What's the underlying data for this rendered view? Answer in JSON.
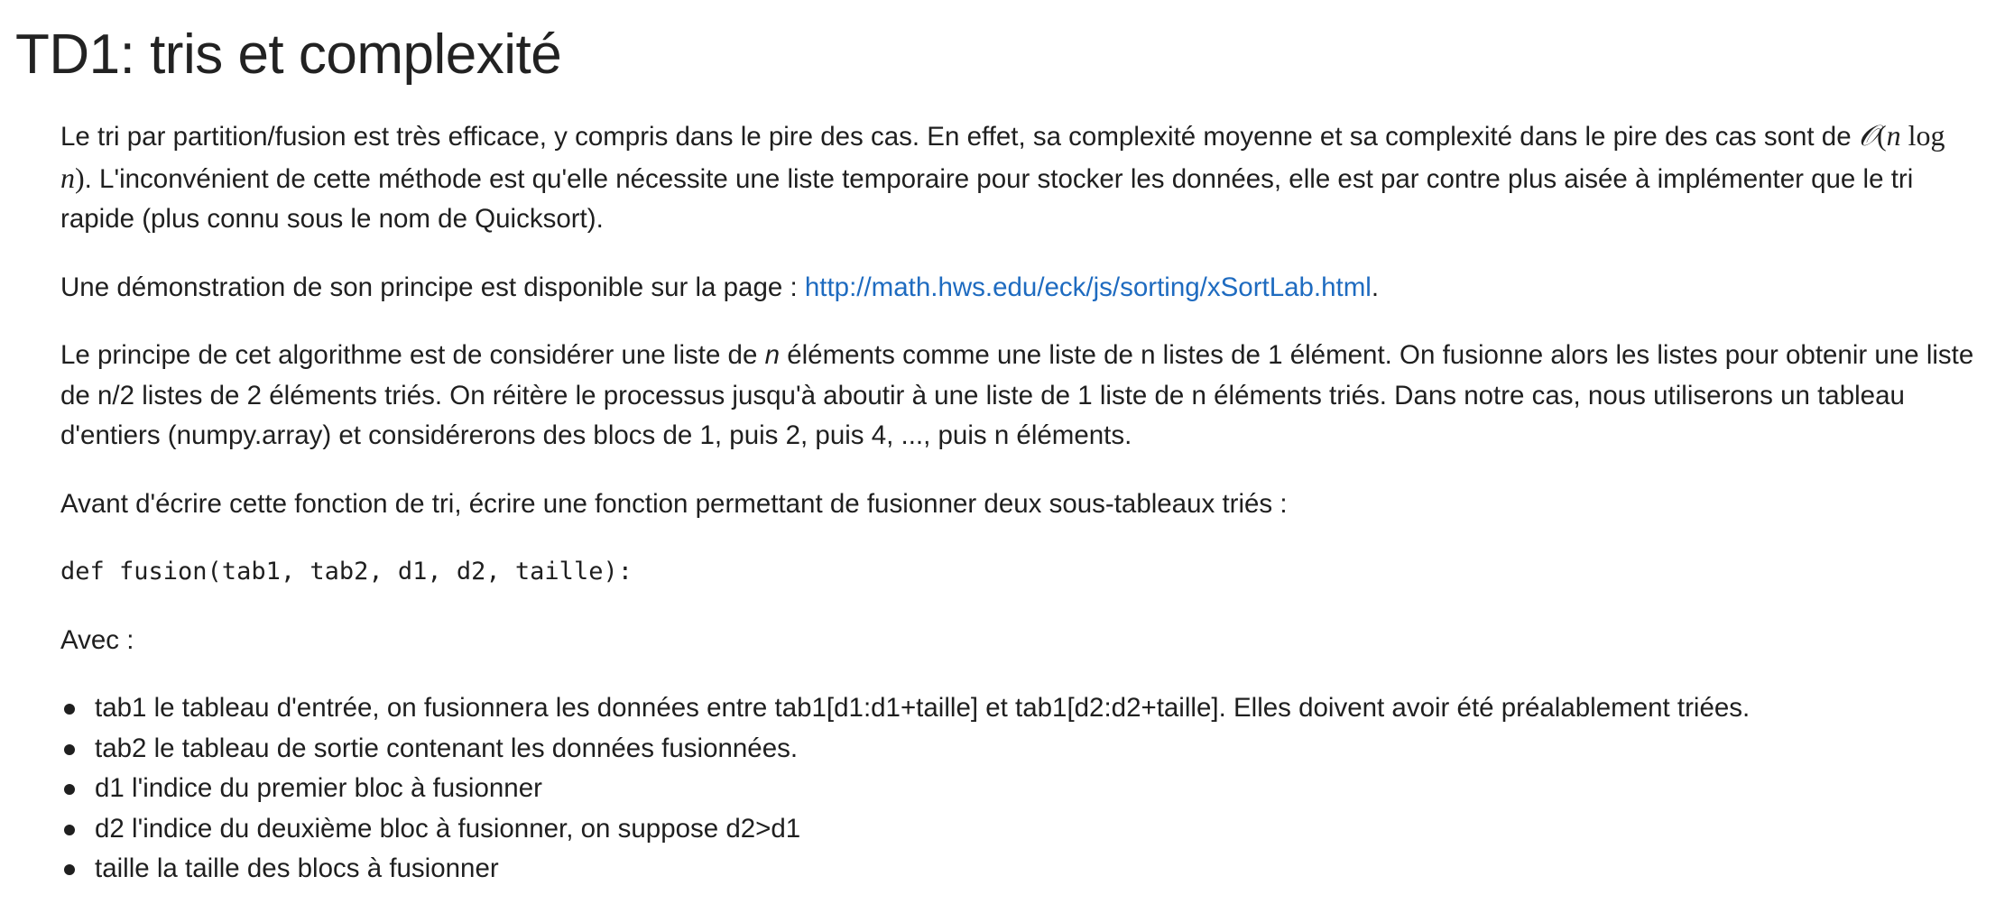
{
  "title": "TD1: tris et complexité",
  "paragraphs": {
    "p1": {
      "part1": "Le tri par partition/fusion est très efficace, y compris dans le pire des cas. En effet, sa complexité moyenne et sa complexité dans le pire des cas sont de ",
      "math_O": "𝒪",
      "math_open": "(",
      "math_n1": "n",
      "math_log": " log ",
      "math_n2": "n",
      "math_close": ")",
      "part2": ". L'inconvénient de cette méthode est qu'elle nécessite une liste temporaire pour stocker les données, elle est par contre plus aisée à implémenter que le tri rapide (plus connu sous le nom de Quicksort)."
    },
    "p2": {
      "before_link": "Une démonstration de son principe est disponible sur la page : ",
      "link_text": "http://math.hws.edu/eck/js/sorting/xSortLab.html",
      "after_link": "."
    },
    "p3": {
      "part1": "Le principe de cet algorithme est de considérer une liste de ",
      "var_n": "n",
      "part2": " éléments comme une liste de n listes de 1 élément. On fusionne alors les listes pour obtenir une liste de n/2 listes de 2 éléments triés. On réitère le processus jusqu'à aboutir à une liste de 1 liste de n éléments triés. Dans notre cas, nous utiliserons un tableau d'entiers (numpy.array) et considérerons des blocs de 1, puis 2, puis 4, ..., puis n éléments."
    },
    "p4": "Avant d'écrire cette fonction de tri, écrire une fonction permettant de fusionner deux sous-tableaux triés :",
    "code": "def fusion(tab1, tab2, d1, d2, taille):",
    "p5": "Avec :"
  },
  "params": [
    "tab1 le tableau d'entrée, on fusionnera les données entre tab1[d1:d1+taille] et tab1[d2:d2+taille]. Elles doivent avoir été préalablement triées.",
    "tab2 le tableau de sortie contenant les données fusionnées.",
    "d1 l'indice du premier bloc à fusionner",
    "d2 l'indice du deuxième bloc à fusionner, on suppose d2>d1",
    "taille la taille des blocs à fusionner"
  ],
  "colors": {
    "link": "#1e6bc0",
    "text": "#1f1f1f",
    "background": "#ffffff"
  }
}
